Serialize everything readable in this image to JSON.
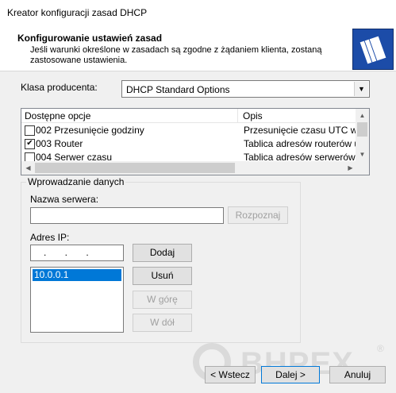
{
  "window": {
    "title": "Kreator konfiguracji zasad DHCP"
  },
  "header": {
    "title": "Konfigurowanie ustawień zasad",
    "subtitle": "Jeśli warunki określone w zasadach są zgodne z żądaniem klienta, zostaną zastosowane ustawienia.",
    "icon": "folders-icon"
  },
  "vendor": {
    "label": "Klasa producenta:",
    "value": "DHCP Standard Options"
  },
  "options_list": {
    "columns": [
      "Dostępne opcje",
      "Opis"
    ],
    "rows": [
      {
        "checked": false,
        "name": "002 Przesunięcie godziny",
        "desc": "Przesunięcie czasu UTC w se"
      },
      {
        "checked": true,
        "name": "003 Router",
        "desc": "Tablica adresów routerów upo"
      },
      {
        "checked": false,
        "name": "004 Serwer czasu",
        "desc": "Tablica adresów serwerów cza"
      }
    ]
  },
  "data_entry": {
    "legend": "Wprowadzanie danych",
    "server_name_label": "Nazwa serwera:",
    "server_name_value": "",
    "resolve_button": "Rozpoznaj",
    "ip_label": "Adres IP:",
    "ip_value": ".       .       .",
    "add_button": "Dodaj",
    "remove_button": "Usuń",
    "up_button": "W górę",
    "down_button": "W dół",
    "ip_list": [
      "10.0.0.1"
    ]
  },
  "footer": {
    "back_button": "< Wstecz",
    "next_button": "Dalej >",
    "cancel_button": "Anuluj"
  },
  "watermark": {
    "text": "BHPEX",
    "mark": "®"
  }
}
